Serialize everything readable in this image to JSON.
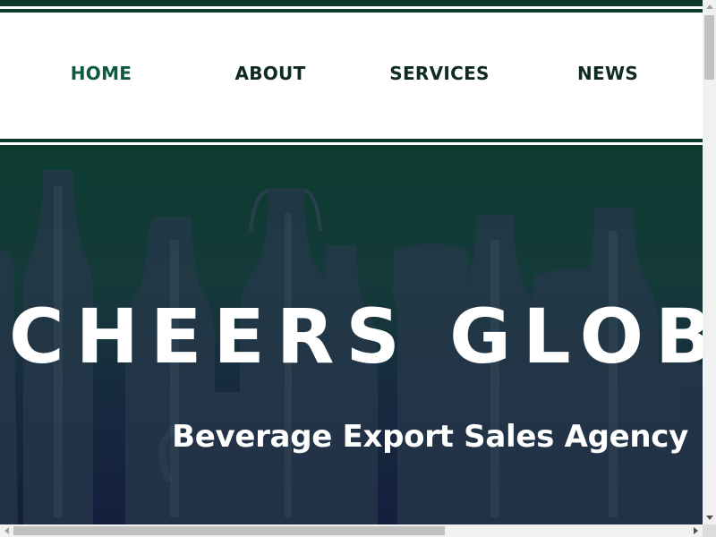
{
  "nav": {
    "items": [
      {
        "label": "HOME",
        "active": true
      },
      {
        "label": "ABOUT",
        "active": false
      },
      {
        "label": "SERVICES",
        "active": false
      },
      {
        "label": "NEWS",
        "active": false
      }
    ]
  },
  "hero": {
    "title": "CHEERS GLOB",
    "subtitle": "Beverage Export Sales Agency"
  },
  "colors": {
    "brand_dark_green": "#0b3a2d",
    "nav_active": "#0f5a3e",
    "nav_text": "#0f2a22",
    "hero_text": "#ffffff"
  },
  "icons": {
    "scroll_up": "chevron-up-icon",
    "scroll_down": "chevron-down-icon",
    "scroll_left": "chevron-left-icon",
    "scroll_right": "chevron-right-icon"
  }
}
